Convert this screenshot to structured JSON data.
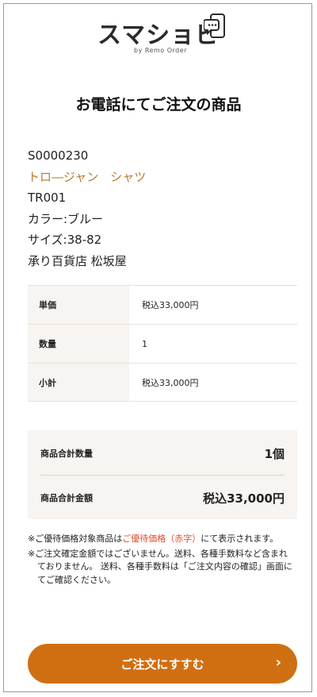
{
  "header": {
    "logo_text": "スマショピ",
    "logo_sub": "by Remo Order",
    "page_title": "お電話にてご注文の商品"
  },
  "product": {
    "code": "S0000230",
    "name": "トロ―ジャン　シャツ",
    "sku": "TR001",
    "color": "カラー:ブルー",
    "size": "サイズ:38-82",
    "store": "承り百貨店 松坂屋"
  },
  "spec_table": [
    {
      "label": "単価",
      "value": "税込33,000円"
    },
    {
      "label": "数量",
      "value": "1"
    },
    {
      "label": "小計",
      "value": "税込33,000円"
    }
  ],
  "summary": {
    "total_qty_label": "商品合計数量",
    "total_qty_value": "1個",
    "total_amount_label": "商品合計金額",
    "total_amount_value": "税込33,000円"
  },
  "notes": {
    "note1_before": "※ご優待価格対象商品は",
    "note1_highlight": "ご優待価格（赤字）",
    "note1_after": "にて表示されます。",
    "note2": "※ご注文確定金額ではございません。送料、各種手数料など含まれておりません。 送料、各種手数料は「ご注文内容の確認」画面にてご確認ください。"
  },
  "button": {
    "label": "ご注文にすすむ",
    "chevron": "›"
  },
  "colors": {
    "accent": "#d06f12",
    "product_name": "#b87a2e",
    "highlight_red": "#e04a2a",
    "panel_bg": "#f7f4f1"
  }
}
